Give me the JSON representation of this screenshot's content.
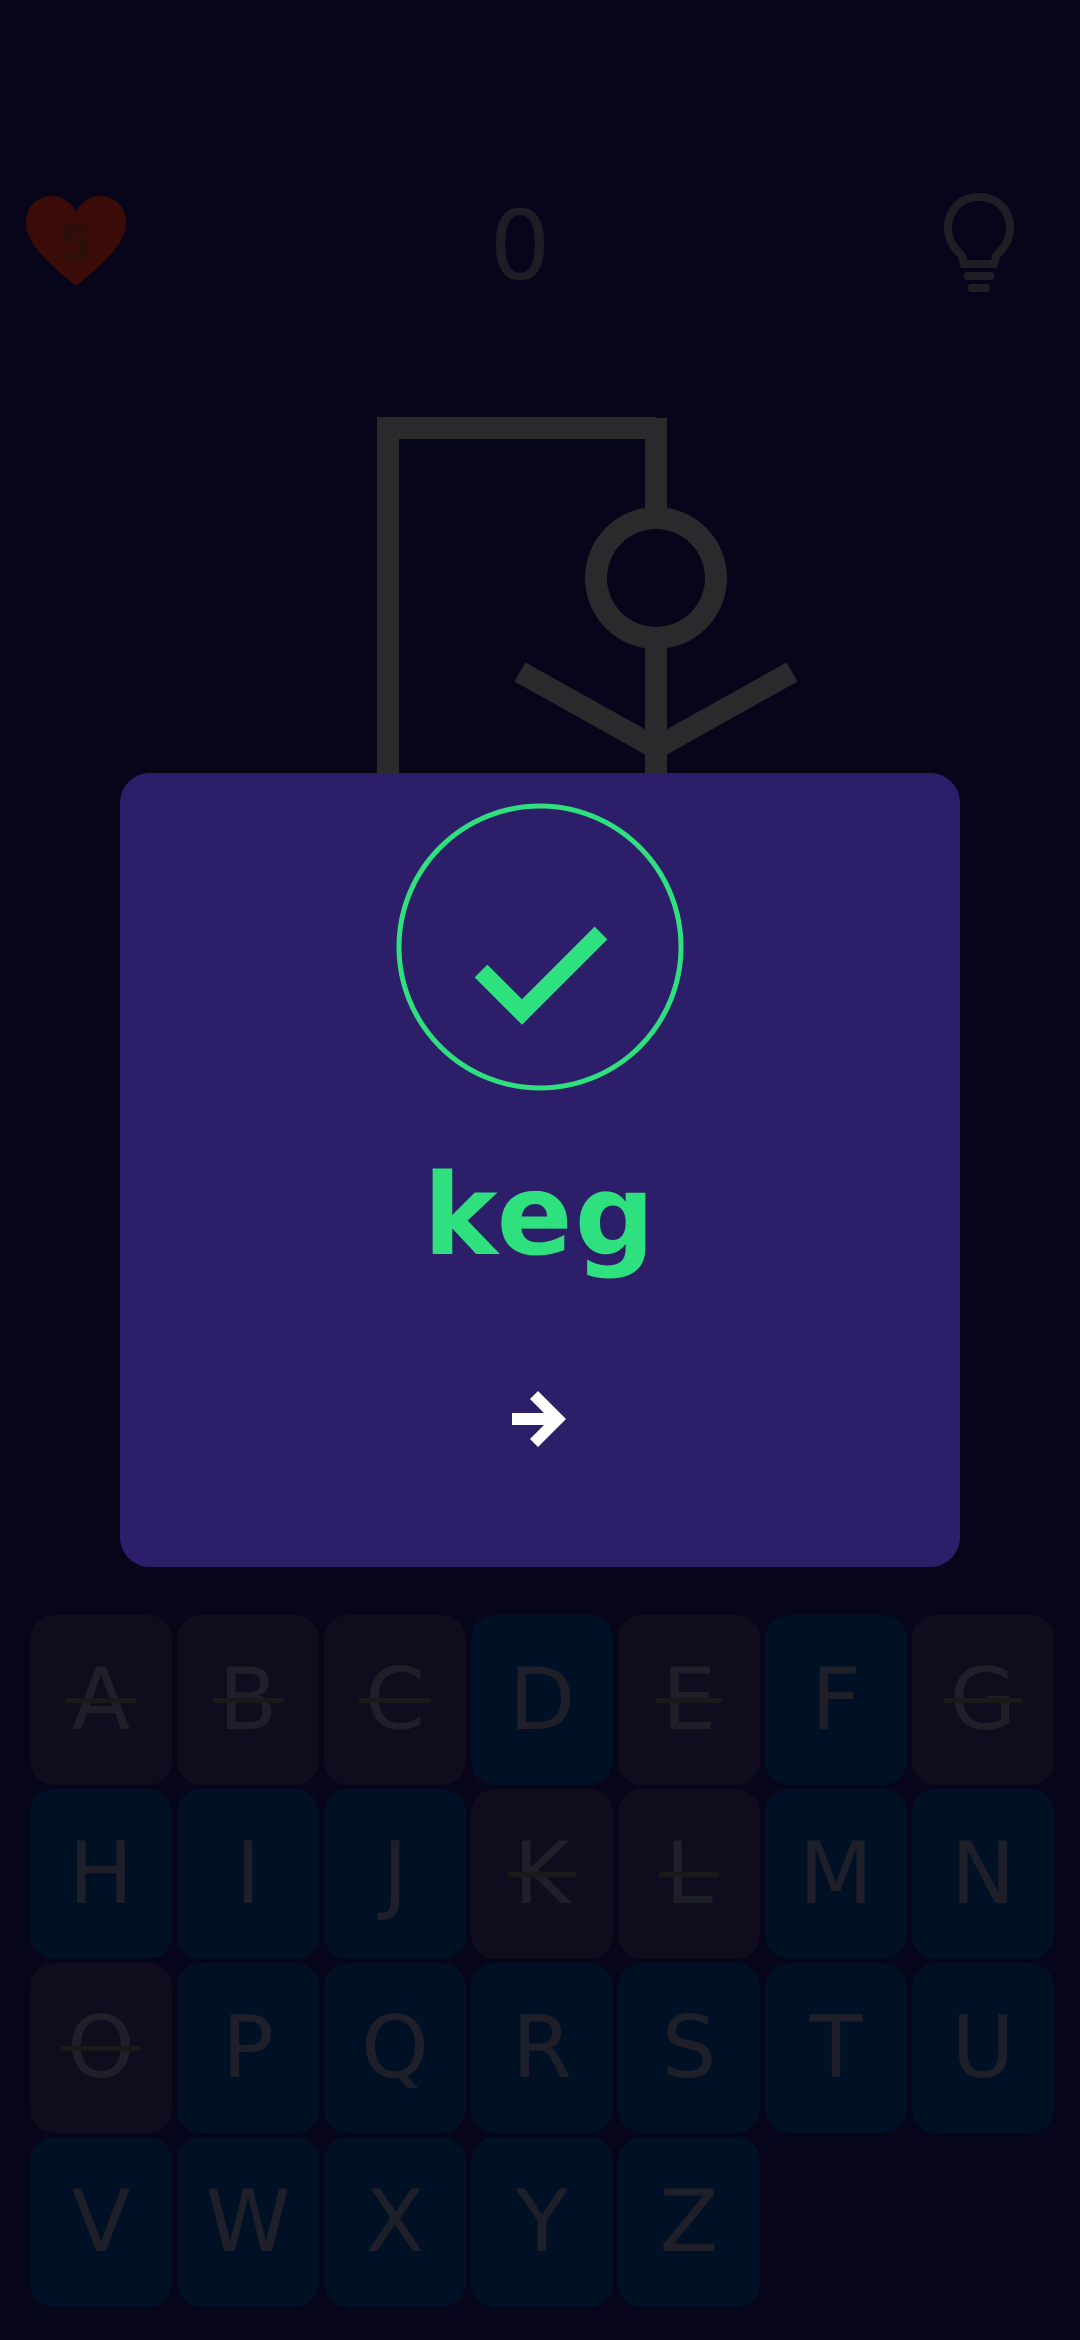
{
  "hud": {
    "lives": "5",
    "score": "0"
  },
  "icons": {
    "lives": "heart-icon",
    "hint": "lightbulb-icon",
    "result": "check-circle-icon",
    "next": "arrow-right-icon"
  },
  "colors": {
    "background": "#07051a",
    "dialog": "#2d1e69",
    "success": "#2fe07e",
    "key_available": "#001126",
    "key_used": "#0e0c1d"
  },
  "dialog": {
    "word": "keg"
  },
  "keyboard": [
    {
      "letter": "A",
      "used": true
    },
    {
      "letter": "B",
      "used": true
    },
    {
      "letter": "C",
      "used": true
    },
    {
      "letter": "D",
      "used": false
    },
    {
      "letter": "E",
      "used": true
    },
    {
      "letter": "F",
      "used": false
    },
    {
      "letter": "G",
      "used": true
    },
    {
      "letter": "H",
      "used": false
    },
    {
      "letter": "I",
      "used": false
    },
    {
      "letter": "J",
      "used": false
    },
    {
      "letter": "K",
      "used": true
    },
    {
      "letter": "L",
      "used": true
    },
    {
      "letter": "M",
      "used": false
    },
    {
      "letter": "N",
      "used": false
    },
    {
      "letter": "O",
      "used": true
    },
    {
      "letter": "P",
      "used": false
    },
    {
      "letter": "Q",
      "used": false
    },
    {
      "letter": "R",
      "used": false
    },
    {
      "letter": "S",
      "used": false
    },
    {
      "letter": "T",
      "used": false
    },
    {
      "letter": "U",
      "used": false
    },
    {
      "letter": "V",
      "used": false
    },
    {
      "letter": "W",
      "used": false
    },
    {
      "letter": "X",
      "used": false
    },
    {
      "letter": "Y",
      "used": false
    },
    {
      "letter": "Z",
      "used": false
    }
  ]
}
